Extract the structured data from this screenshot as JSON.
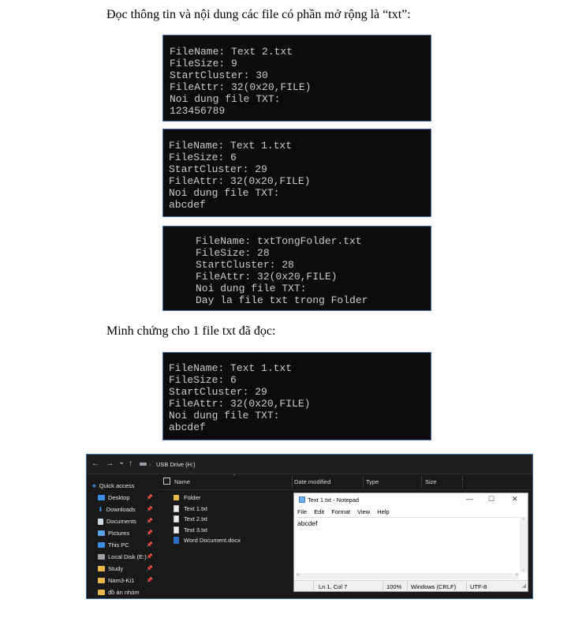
{
  "headings": {
    "read_txt": "Đọc thông tin và nội dung các file có phần mở rộng là “txt”:",
    "proof": "Minh chứng cho 1 file txt đã đọc:"
  },
  "terminals": [
    [
      "FileName: Text 2.txt",
      "FileSize: 9",
      "StartCluster: 30",
      "FileAttr: 32(0x20,FILE)",
      "Noi dung file TXT:",
      "123456789"
    ],
    [
      "FileName: Text 1.txt",
      "FileSize: 6",
      "StartCluster: 29",
      "FileAttr: 32(0x20,FILE)",
      "Noi dung file TXT:",
      "abcdef"
    ],
    [
      "FileName: txtTongFolder.txt",
      "FileSize: 28",
      "StartCluster: 28",
      "FileAttr: 32(0x20,FILE)",
      "Noi dung file TXT:",
      "Day la file txt trong Folder"
    ],
    [
      "FileName: Text 1.txt",
      "FileSize: 6",
      "StartCluster: 29",
      "FileAttr: 32(0x20,FILE)",
      "Noi dung file TXT:",
      "abcdef"
    ]
  ],
  "explorer": {
    "address": "USB Drive (H:)",
    "nav": {
      "back": "←",
      "forward": "→",
      "recent": "⌄",
      "up": "↑"
    },
    "columns": {
      "name": "Name",
      "date": "Date modified",
      "type": "Type",
      "size": "Size"
    },
    "sidebar": [
      {
        "label": "Quick access",
        "icon": "star-icon",
        "color": "#3a8ee6"
      },
      {
        "label": "Desktop",
        "icon": "desktop-icon",
        "color": "#3a8ee6"
      },
      {
        "label": "Downloads",
        "icon": "download-icon",
        "color": "#3a8ee6"
      },
      {
        "label": "Documents",
        "icon": "documents-icon",
        "color": "#cfd8e3"
      },
      {
        "label": "Pictures",
        "icon": "pictures-icon",
        "color": "#5aa0e6"
      },
      {
        "label": "This PC",
        "icon": "pc-icon",
        "color": "#3a8ee6"
      },
      {
        "label": "Local Disk (E:)",
        "icon": "disk-icon",
        "color": "#9aa0a6"
      },
      {
        "label": "Study",
        "icon": "folder-icon",
        "color": "#e8b84a"
      },
      {
        "label": "Nam3-Ki1",
        "icon": "folder-icon",
        "color": "#e8b84a"
      },
      {
        "label": "đồ án nhóm",
        "icon": "folder-icon",
        "color": "#e8b84a"
      }
    ],
    "files": [
      {
        "name": "Folder",
        "kind": "folder"
      },
      {
        "name": "Text 1.txt",
        "kind": "txt"
      },
      {
        "name": "Text 2.txt",
        "kind": "txt"
      },
      {
        "name": "Text 3.txt",
        "kind": "txt"
      },
      {
        "name": "Word Document.docx",
        "kind": "docx"
      }
    ],
    "notepad": {
      "title": "Text 1.txt - Notepad",
      "menu": [
        "File",
        "Edit",
        "Format",
        "View",
        "Help"
      ],
      "content": "abcdef",
      "status": {
        "position": "Ln 1, Col 7",
        "zoom": "100%",
        "eol": "Windows (CRLF)",
        "encoding": "UTF-8"
      },
      "controls": {
        "minimize": "—",
        "maximize": "☐",
        "close": "✕"
      }
    }
  }
}
